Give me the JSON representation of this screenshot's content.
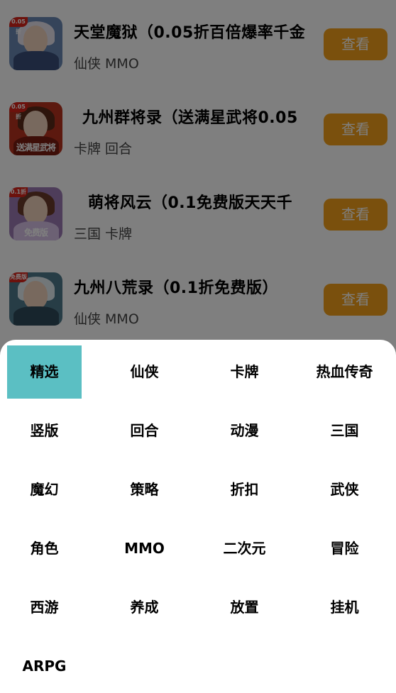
{
  "games": [
    {
      "title": "天堂魔狱（0.05折百倍爆率千金",
      "tags": "仙侠 MMO",
      "button": "查看",
      "badge": "0.05折",
      "caption": "",
      "colors": {
        "bg": "#6a88b5",
        "hair": "#e8e4ef",
        "body": "#3b4f7a"
      }
    },
    {
      "title": "九州群将录（送满星武将0.05",
      "tags": "卡牌 回合",
      "button": "查看",
      "badge": "0.05折",
      "caption": "送满星武将",
      "colors": {
        "bg": "#b8321e",
        "hair": "#5a2a18",
        "body": "#7a1d10"
      }
    },
    {
      "title": "萌将风云（0.1免费版天天千",
      "tags": "三国 卡牌",
      "button": "查看",
      "badge": "0.1折",
      "caption": "免费版",
      "colors": {
        "bg": "#9c7bb5",
        "hair": "#6a3b2a",
        "body": "#d8c3e8"
      }
    },
    {
      "title": "九州八荒录（0.1折免费版）",
      "tags": "仙侠 MMO",
      "button": "查看",
      "badge": "免费版",
      "caption": "",
      "colors": {
        "bg": "#4f7a8c",
        "hair": "#e4eef3",
        "body": "#2f4b5a"
      }
    }
  ],
  "categories": [
    {
      "label": "精选",
      "selected": true
    },
    {
      "label": "仙侠"
    },
    {
      "label": "卡牌"
    },
    {
      "label": "热血传奇"
    },
    {
      "label": "竖版"
    },
    {
      "label": "回合"
    },
    {
      "label": "动漫"
    },
    {
      "label": "三国"
    },
    {
      "label": "魔幻"
    },
    {
      "label": "策略"
    },
    {
      "label": "折扣"
    },
    {
      "label": "武侠"
    },
    {
      "label": "角色"
    },
    {
      "label": "MMO"
    },
    {
      "label": "二次元"
    },
    {
      "label": "冒险"
    },
    {
      "label": "西游"
    },
    {
      "label": "养成"
    },
    {
      "label": "放置"
    },
    {
      "label": "挂机"
    },
    {
      "label": "ARPG"
    }
  ],
  "colors": {
    "accent": "#5bbfc3",
    "button": "#f4a11a",
    "overlay": "rgba(0,0,0,0.5)"
  }
}
